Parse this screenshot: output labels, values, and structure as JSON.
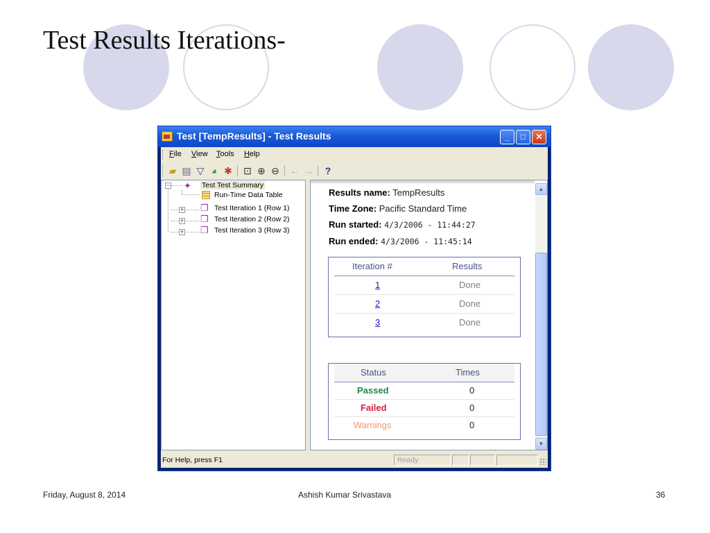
{
  "slide": {
    "title": "Test Results Iterations-",
    "footer_date": "Friday, August 8, 2014",
    "footer_author": "Ashish Kumar Srivastava",
    "footer_page": "36"
  },
  "window": {
    "title": "Test [TempResults] - Test Results",
    "menu": [
      {
        "accel": "F",
        "rest": "ile"
      },
      {
        "accel": "V",
        "rest": "iew"
      },
      {
        "accel": "T",
        "rest": "ools"
      },
      {
        "accel": "H",
        "rest": "elp"
      }
    ],
    "toolbar_icons": [
      "open-icon",
      "print-icon",
      "filter-icon",
      "find-icon",
      "qc-icon",
      "zoom-fit-icon",
      "zoom-in-icon",
      "zoom-out-icon",
      "back-icon",
      "forward-icon",
      "help-icon"
    ]
  },
  "tree": {
    "root": "Test Test Summary",
    "data_table": "Run-Time Data Table",
    "iterations": [
      "Test Iteration 1 (Row 1)",
      "Test Iteration 2 (Row 2)",
      "Test Iteration 3 (Row 3)"
    ]
  },
  "summary": {
    "results_name_label": "Results name:",
    "results_name": "TempResults",
    "time_zone_label": "Time Zone:",
    "time_zone": "Pacific Standard Time",
    "run_started_label": "Run started:",
    "run_started": "4/3/2006 - 11:44:27",
    "run_ended_label": "Run ended:",
    "run_ended": "4/3/2006 - 11:45:14"
  },
  "iterations_table": {
    "headers": [
      "Iteration #",
      "Results"
    ],
    "rows": [
      {
        "iteration": "1",
        "result": "Done"
      },
      {
        "iteration": "2",
        "result": "Done"
      },
      {
        "iteration": "3",
        "result": "Done"
      }
    ]
  },
  "status_table": {
    "headers": [
      "Status",
      "Times"
    ],
    "rows": [
      {
        "status": "Passed",
        "times": "0",
        "color": "#1a8a4a"
      },
      {
        "status": "Failed",
        "times": "0",
        "color": "#d81e3c"
      },
      {
        "status": "Warnings",
        "times": "0",
        "color": "#f39a5a"
      }
    ]
  },
  "statusbar": {
    "help": "For Help, press F1",
    "ready": "Ready"
  },
  "colors": {
    "circle": "#d8d8ec",
    "titlebar": "#1a5ad8",
    "link": "#1a1ac8",
    "done": "#808080"
  }
}
